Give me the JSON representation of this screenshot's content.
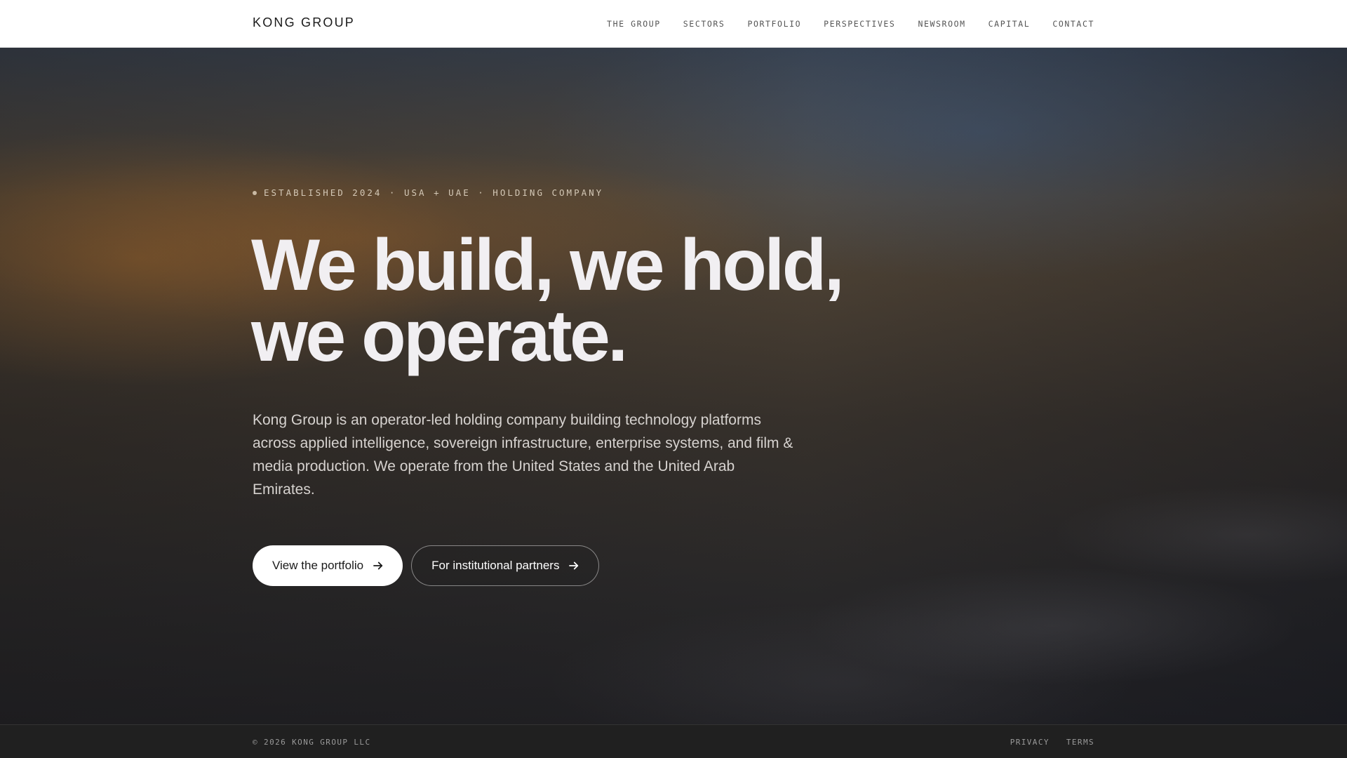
{
  "header": {
    "brand": "KONG GROUP",
    "nav": [
      {
        "label": "THE GROUP"
      },
      {
        "label": "SECTORS"
      },
      {
        "label": "PORTFOLIO"
      },
      {
        "label": "PERSPECTIVES"
      },
      {
        "label": "NEWSROOM"
      },
      {
        "label": "CAPITAL"
      },
      {
        "label": "CONTACT"
      }
    ]
  },
  "hero": {
    "eyebrow": "ESTABLISHED 2024 · USA + UAE · HOLDING COMPANY",
    "headline_line1": "We build, we hold,",
    "headline_line2": "we operate.",
    "lead": "Kong Group is an operator-led holding company building technology platforms across applied intelligence, sovereign infrastructure, enterprise systems, and film & media production. We operate from the United States and the United Arab Emirates.",
    "primary_cta": {
      "label": "View the portfolio",
      "icon": "arrow-right-icon"
    },
    "secondary_cta": {
      "label": "For institutional partners",
      "icon": "arrow-right-icon"
    }
  },
  "footer": {
    "copyright": "© 2026 KONG GROUP LLC",
    "links": [
      {
        "label": "PRIVACY"
      },
      {
        "label": "TERMS"
      }
    ]
  },
  "colors": {
    "nav_background": "#ffffff",
    "footer_background": "#202020",
    "headline_text": "#f1eff2",
    "primary_button": "#ffffff"
  }
}
